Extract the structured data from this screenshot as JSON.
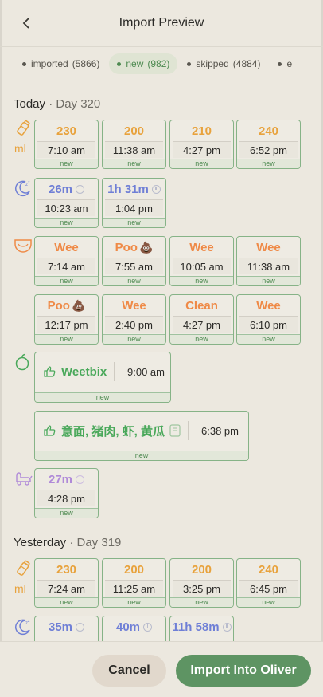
{
  "header": {
    "title": "Import Preview"
  },
  "tabs": [
    {
      "label": "imported",
      "count": "(5866)"
    },
    {
      "label": "new",
      "count": "(982)"
    },
    {
      "label": "skipped",
      "count": "(4884)"
    },
    {
      "label": "e"
    }
  ],
  "days": [
    {
      "label": "Today",
      "sub": "· Day 320"
    },
    {
      "label": "Yesterday",
      "sub": "· Day 319"
    }
  ],
  "today": {
    "bottle_unit": "ml",
    "bottles": [
      {
        "amount": "230",
        "time": "7:10 am",
        "status": "new"
      },
      {
        "amount": "200",
        "time": "11:38 am",
        "status": "new"
      },
      {
        "amount": "210",
        "time": "4:27 pm",
        "status": "new"
      },
      {
        "amount": "240",
        "time": "6:52 pm",
        "status": "new"
      }
    ],
    "sleeps": [
      {
        "duration": "26m",
        "time": "10:23 am",
        "status": "new"
      },
      {
        "duration": "1h 31m",
        "time": "1:04 pm",
        "status": "new"
      }
    ],
    "diapers": [
      {
        "type": "Wee",
        "time": "7:14 am",
        "status": "new"
      },
      {
        "type": "Poo",
        "time": "7:55 am",
        "status": "new",
        "emoji": "💩"
      },
      {
        "type": "Wee",
        "time": "10:05 am",
        "status": "new"
      },
      {
        "type": "Wee",
        "time": "11:38 am",
        "status": "new"
      },
      {
        "type": "Poo",
        "time": "12:17 pm",
        "status": "new",
        "emoji": "💩"
      },
      {
        "type": "Wee",
        "time": "2:40 pm",
        "status": "new"
      },
      {
        "type": "Clean",
        "time": "4:27 pm",
        "status": "new"
      },
      {
        "type": "Wee",
        "time": "6:10 pm",
        "status": "new"
      }
    ],
    "meals": [
      {
        "food": "Weetbix",
        "time": "9:00 am",
        "status": "new"
      },
      {
        "food": "意面, 猪肉, 虾, 黄瓜",
        "time": "6:38 pm",
        "status": "new"
      }
    ],
    "play": [
      {
        "duration": "27m",
        "time": "4:28 pm",
        "status": "new"
      }
    ]
  },
  "yesterday": {
    "bottle_unit": "ml",
    "bottles": [
      {
        "amount": "230",
        "time": "7:24 am",
        "status": "new"
      },
      {
        "amount": "200",
        "time": "11:25 am",
        "status": "new"
      },
      {
        "amount": "200",
        "time": "3:25 pm",
        "status": "new"
      },
      {
        "amount": "240",
        "time": "6:45 pm",
        "status": "new"
      }
    ],
    "sleeps": [
      {
        "duration": "35m"
      },
      {
        "duration": "40m"
      },
      {
        "duration": "11h 58m"
      }
    ]
  },
  "footer": {
    "cancel": "Cancel",
    "import": "Import Into Oliver"
  },
  "colors": {
    "background": "#ece8df",
    "accent": "#5e9463",
    "bottle": "#e8a23c",
    "sleep": "#6f7fd6",
    "diaper": "#ef8a47",
    "meal": "#49a85a",
    "play": "#b08ad8"
  },
  "icons": {
    "back": "chevron-left-icon",
    "bottle": "bottle-icon",
    "sleep": "moon-icon",
    "diaper": "diaper-icon",
    "meal": "apple-icon",
    "play": "toy-dog-icon",
    "like": "thumbs-up-icon",
    "note": "note-icon",
    "duration": "clock-icon"
  }
}
